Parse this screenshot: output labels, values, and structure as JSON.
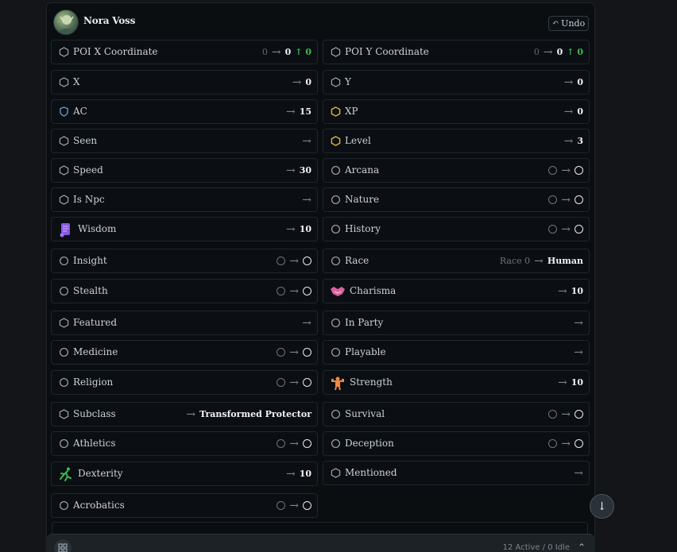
{
  "header": {
    "name": "Nora Voss",
    "undo_label": "Undo"
  },
  "rows_left": [
    {
      "label": "POI X Coordinate",
      "icon": "hexagon-icon",
      "old": "0",
      "new": "0",
      "delta": "0"
    },
    {
      "label": "X",
      "icon": "hexagon-icon",
      "new": "0"
    },
    {
      "label": "AC",
      "icon": "shield-icon",
      "new": "15"
    },
    {
      "label": "Seen",
      "icon": "hexagon-icon"
    },
    {
      "label": "Speed",
      "icon": "hexagon-icon",
      "new": "30"
    },
    {
      "label": "Is Npc",
      "icon": "hexagon-icon"
    },
    {
      "label": "Wisdom",
      "icon": "scroll-icon",
      "new": "10"
    },
    {
      "label": "Insight",
      "icon": "circle-icon",
      "circles": true
    },
    {
      "label": "Stealth",
      "icon": "circle-icon",
      "circles": true
    },
    {
      "label": "Featured",
      "icon": "hexagon-icon"
    },
    {
      "label": "Medicine",
      "icon": "circle-icon",
      "circles": true
    },
    {
      "label": "Religion",
      "icon": "circle-icon",
      "circles": true
    },
    {
      "label": "Subclass",
      "icon": "hexagon-icon",
      "new": "Transformed Protector"
    },
    {
      "label": "Athletics",
      "icon": "circle-icon",
      "circles": true
    },
    {
      "label": "Dexterity",
      "icon": "runner-icon",
      "new": "10"
    },
    {
      "label": "Acrobatics",
      "icon": "circle-icon",
      "circles": true
    }
  ],
  "rows_right": [
    {
      "label": "POI Y Coordinate",
      "icon": "hexagon-icon",
      "old": "0",
      "new": "0",
      "delta": "0"
    },
    {
      "label": "Y",
      "icon": "hexagon-icon",
      "new": "0"
    },
    {
      "label": "XP",
      "icon": "hexagon-gold-icon",
      "new": "0"
    },
    {
      "label": "Level",
      "icon": "hexagon-gold-icon",
      "new": "3"
    },
    {
      "label": "Arcana",
      "icon": "circle-icon",
      "circles": true
    },
    {
      "label": "Nature",
      "icon": "circle-icon",
      "circles": true
    },
    {
      "label": "History",
      "icon": "circle-icon",
      "circles": true
    },
    {
      "label": "Race",
      "icon": "circle-icon",
      "old": "Race 0",
      "new": "Human"
    },
    {
      "label": "Charisma",
      "icon": "handshake-icon",
      "new": "10"
    },
    {
      "label": "In Party",
      "icon": "circle-icon"
    },
    {
      "label": "Playable",
      "icon": "circle-icon"
    },
    {
      "label": "Strength",
      "icon": "strongman-icon",
      "new": "10"
    },
    {
      "label": "Survival",
      "icon": "circle-icon",
      "circles": true
    },
    {
      "label": "Deception",
      "icon": "circle-icon",
      "circles": true
    },
    {
      "label": "Mentioned",
      "icon": "hexagon-icon"
    }
  ],
  "footer": {
    "status": "12 Active / 0 Idle"
  },
  "colors": {
    "background": "#131518",
    "panel": "#0a0e11",
    "delta_green": "#3fb950",
    "gold": "#e3b341",
    "shield_blue": "#6f9fd8"
  }
}
